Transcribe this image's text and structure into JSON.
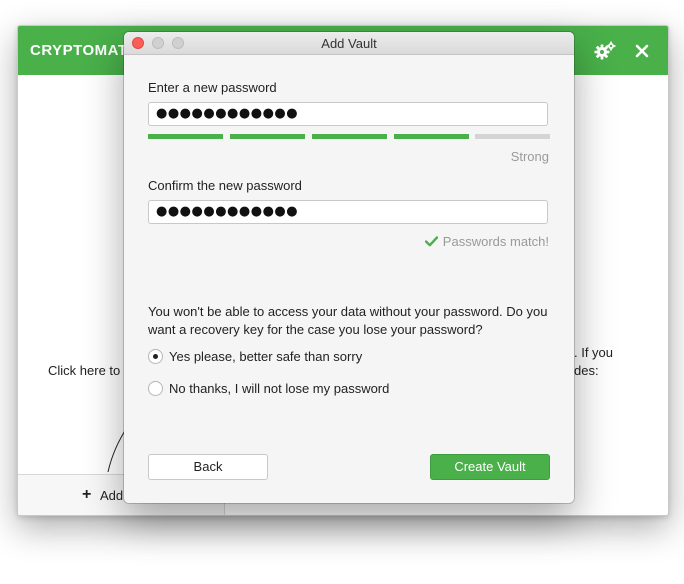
{
  "app": {
    "title": "CRYPTOMAT",
    "sidebar_add_label": "Add",
    "click_here_text": "Click here to",
    "right_hint_line1": ". If you",
    "right_hint_line2": "des:",
    "icons": {
      "settings": "settings-gears-icon",
      "close": "close-icon",
      "add": "plus-icon"
    },
    "accent_color": "#49b04a"
  },
  "dialog": {
    "title": "Add Vault",
    "new_password_label": "Enter a new password",
    "new_password_value": "●●●●●●●●●●●●",
    "strength": {
      "filled_segments": 4,
      "total_segments": 5,
      "label": "Strong"
    },
    "confirm_password_label": "Confirm the new password",
    "confirm_password_value": "●●●●●●●●●●●●",
    "match_text": "Passwords match!",
    "recovery_question": "You won't be able to access your data without your password. Do you want a recovery key for the case you lose your password?",
    "options": [
      {
        "label": "Yes please, better safe than sorry",
        "selected": true
      },
      {
        "label": "No thanks, I will not lose my password",
        "selected": false
      }
    ],
    "back_button": "Back",
    "create_button": "Create Vault"
  }
}
